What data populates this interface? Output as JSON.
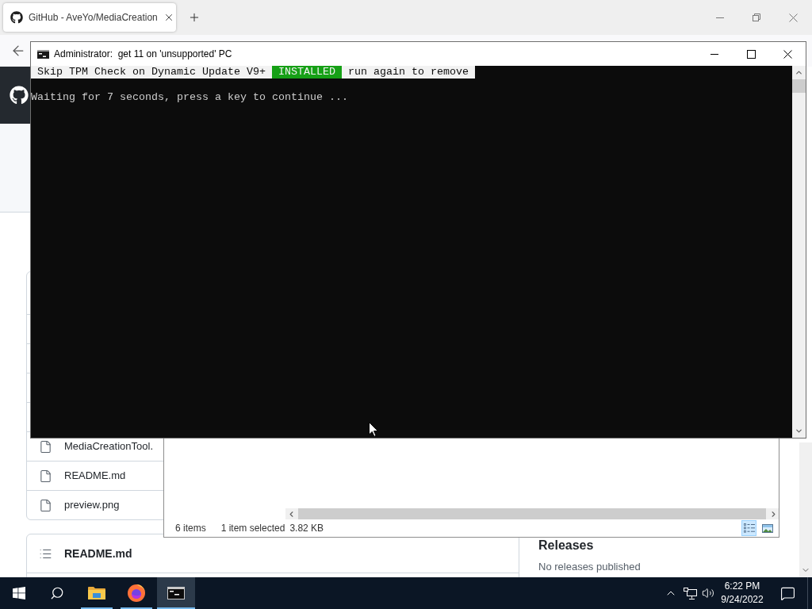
{
  "browser": {
    "tabs": [
      {
        "title": "GitHub - AveYo/MediaCreation",
        "selected": true
      }
    ]
  },
  "github_page": {
    "files": [
      {
        "name": "MediaCreationTool."
      },
      {
        "name": "README.md"
      },
      {
        "name": "preview.png"
      }
    ],
    "readme_title": "README.md",
    "releases": {
      "title": "Releases",
      "text": "No releases published"
    }
  },
  "explorer": {
    "status": {
      "item_count": "6 items",
      "selection": "1 item selected",
      "size": "3.82 KB"
    },
    "views": [
      {
        "kind": "details",
        "selected": true
      },
      {
        "kind": "large_icons",
        "selected": false
      }
    ]
  },
  "console_window": {
    "title": "Administrator:  get 11 on 'unsupported' PC",
    "banner": [
      {
        "text": "Skip TPM Check on Dynamic Update V9+",
        "kind": "inverse"
      },
      {
        "text": "INSTALLED",
        "kind": "success"
      },
      {
        "text": "run again to remove",
        "kind": "inverse"
      }
    ],
    "output": [
      "Waiting for 7 seconds, press a key to continue ..."
    ]
  },
  "taskbar": {
    "apps": [
      {
        "kind": "file_explorer",
        "running": true,
        "selected": false
      },
      {
        "kind": "firefox",
        "running": true,
        "selected": false
      },
      {
        "kind": "console",
        "running": true,
        "selected": true
      }
    ],
    "clock": {
      "time": "6:22 PM",
      "date": "9/24/2022"
    }
  }
}
